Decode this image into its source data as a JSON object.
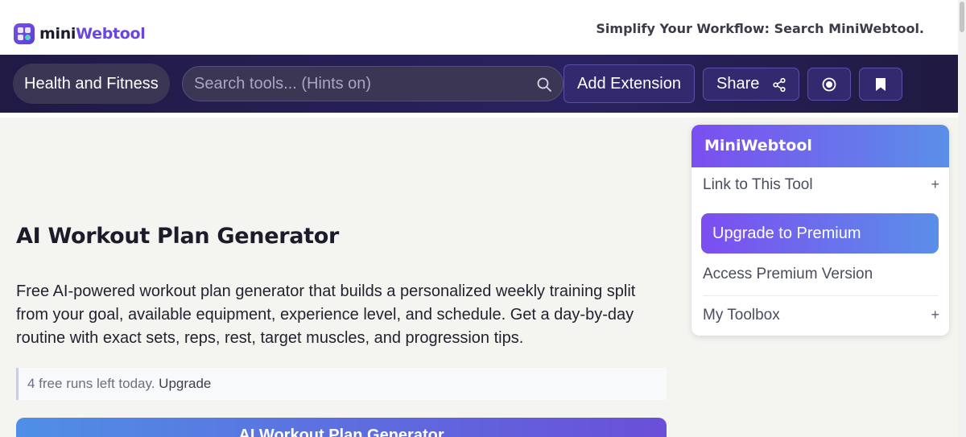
{
  "header": {
    "logo_part1": "mini",
    "logo_part2": "Webtool",
    "tagline": "Simplify Your Workflow: Search MiniWebtool."
  },
  "nav": {
    "category": "Health and Fitness",
    "search_placeholder": "Search tools... (Hints on)",
    "add_extension": "Add Extension",
    "share": "Share",
    "icons": [
      "search-icon",
      "share-icon",
      "record-icon",
      "bookmark-icon"
    ]
  },
  "main": {
    "title": "AI Workout Plan Generator",
    "description": "Free AI-powered workout plan generator that builds a personalized weekly training split from your goal, available equipment, experience level, and schedule. Get a day-by-day routine with exact sets, reps, rest, target muscles, and progression tips.",
    "notice_text": "4 free runs left today.",
    "notice_link": "Upgrade",
    "generate_button": "AI Workout Plan Generator"
  },
  "sidebar": {
    "title": "MiniWebtool",
    "link_to_tool": "Link to This Tool",
    "upgrade": "Upgrade to Premium",
    "access_premium": "Access Premium Version",
    "my_toolbox": "My Toolbox",
    "expand_symbol": "+"
  },
  "colors": {
    "brand_purple": "#6a45e0",
    "nav_bg": "#201a45",
    "gradient_start": "#7c4ef0",
    "gradient_end": "#5a8fe8"
  }
}
